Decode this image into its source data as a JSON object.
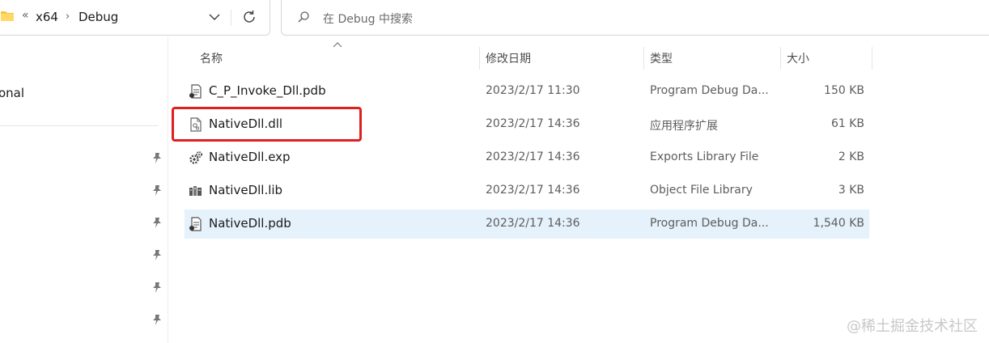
{
  "address": {
    "sep_double": "«",
    "crumbs": [
      "x64",
      "Debug"
    ],
    "sep": "›"
  },
  "search": {
    "placeholder": "在 Debug 中搜索"
  },
  "nav": {
    "partial_item": "onal"
  },
  "columns": {
    "name": "名称",
    "date": "修改日期",
    "type": "类型",
    "size": "大小"
  },
  "files": [
    {
      "name": "C_P_Invoke_Dll.pdb",
      "date": "2023/2/17 11:30",
      "type": "Program Debug Da...",
      "size": "150 KB",
      "icon": "pdb-file-icon"
    },
    {
      "name": "NativeDll.dll",
      "date": "2023/2/17 14:36",
      "type": "应用程序扩展",
      "size": "61 KB",
      "icon": "dll-file-icon"
    },
    {
      "name": "NativeDll.exp",
      "date": "2023/2/17 14:36",
      "type": "Exports Library File",
      "size": "2 KB",
      "icon": "exp-file-icon"
    },
    {
      "name": "NativeDll.lib",
      "date": "2023/2/17 14:36",
      "type": "Object File Library",
      "size": "3 KB",
      "icon": "lib-file-icon"
    },
    {
      "name": "NativeDll.pdb",
      "date": "2023/2/17 14:36",
      "type": "Program Debug Da...",
      "size": "1,540 KB",
      "icon": "pdb-file-icon"
    }
  ],
  "highlight_color": "#e02020",
  "selected_color": "#e5f1fb",
  "watermark": "@稀土掘金技术社区"
}
